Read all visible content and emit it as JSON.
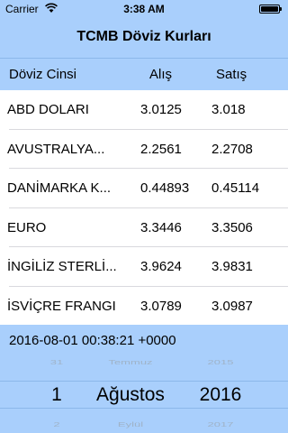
{
  "status": {
    "carrier": "Carrier",
    "time": "3:38 AM",
    "wifi_icon": "wifi-icon",
    "battery_icon": "battery-icon",
    "battery_level": 1.0
  },
  "nav": {
    "title": "TCMB Döviz Kurları"
  },
  "table": {
    "headers": {
      "name": "Döviz Cinsi",
      "alis": "Alış",
      "satis": "Satış"
    },
    "rows": [
      {
        "name": "ABD DOLARI",
        "alis": "3.0125",
        "satis": "3.018"
      },
      {
        "name": "AVUSTRALYA...",
        "alis": "2.2561",
        "satis": "2.2708"
      },
      {
        "name": "DANİMARKA K...",
        "alis": "0.44893",
        "satis": "0.45114"
      },
      {
        "name": "EURO",
        "alis": "3.3446",
        "satis": "3.3506"
      },
      {
        "name": "İNGİLİZ STERLİ...",
        "alis": "3.9624",
        "satis": "3.9831"
      },
      {
        "name": "İSVİÇRE FRANGI",
        "alis": "3.0789",
        "satis": "3.0987"
      }
    ]
  },
  "date_label": "2016-08-01 00:38:21 +0000",
  "picker": {
    "day": {
      "prev": "31",
      "current": "1",
      "next": "2"
    },
    "month": {
      "prev": "Temmuz",
      "current": "Ağustos",
      "next": "Eylül"
    },
    "year": {
      "prev": "2015",
      "current": "2016",
      "next": "2017"
    }
  },
  "colors": {
    "accent": "#a9cffc",
    "separator": "#d9d9de"
  }
}
